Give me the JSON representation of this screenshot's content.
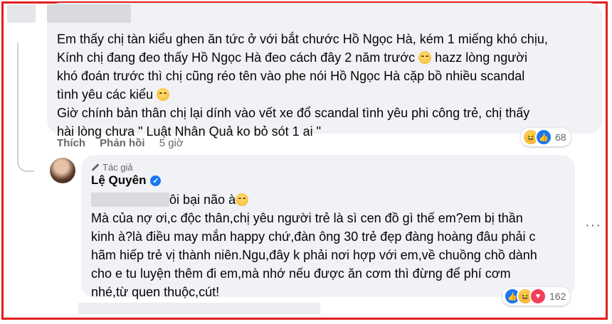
{
  "comment": {
    "lines": [
      "Em thấy chị tàn kiểu ghen ăn tức ở với bắt chước Hồ Ngọc Hà, kém 1 miếng khó chịu,",
      "Kính chị đang đeo thấy Hồ Ngọc Hà đeo cách đây 2 năm trước",
      "hazz lòng người",
      "khó đoán trước thì chị cũng réo tên vào phe nói Hồ Ngọc Hà cặp bồ nhiều scandal",
      "tình yêu các kiểu",
      "Giờ chính bản thân chị lại dính vào vết xe đổ scandal tình yêu phi công trẻ, chị thấy",
      "hài lòng chưa \" Luật Nhân Quả ko bỏ sót 1 ai \""
    ],
    "actions": {
      "like": "Thích",
      "reply": "Phản hồi",
      "time": "5 giờ"
    },
    "reactions": {
      "icons": [
        "haha-icon",
        "like-icon"
      ],
      "count": "68"
    }
  },
  "reply": {
    "badge": "Tác giả",
    "author": "Lệ Quyên",
    "mention_suffix": "ôi bại não à",
    "lines": [
      "Mà của nợ ơi,c độc thân,chị yêu người trẻ là sì cen đồ gì thế em?em bị thần",
      "kinh à?là điều may mắn happy chứ,đàn ông 30 trẻ đẹp đàng hoàng đâu phải c",
      "hãm hiếp trẻ vị thành niên.Ngu,đây k phải nơi hợp với em,về chuồng chồ dành",
      "cho e tu luyện thêm đi em,mà nhớ nếu được ăn cơm thì đừng để phí cơm",
      "nhé,từ quen thuộc,cút!"
    ],
    "reactions": {
      "icons": [
        "like-icon",
        "haha-icon",
        "love-icon"
      ],
      "count": "162"
    },
    "more": "···"
  },
  "colors": {
    "frame": "#e0201e",
    "bubble": "#f0f2f5",
    "like": "#1877f2",
    "love": "#f33e58"
  }
}
